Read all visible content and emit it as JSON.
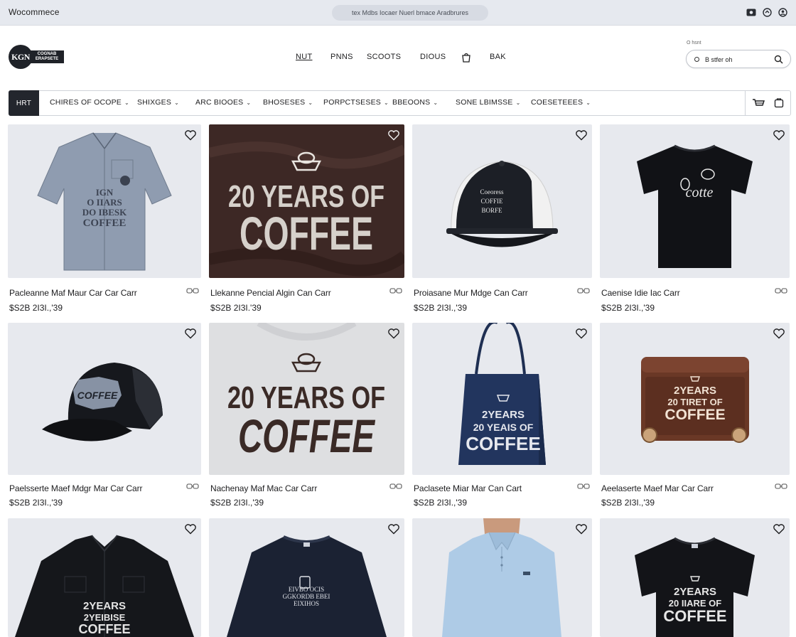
{
  "browser": {
    "title": "Wocommece",
    "url": "tex  Mdbs Iocaer Nuerl bmace  Aradbrures"
  },
  "site": {
    "logo_badge": "KGN",
    "logo_text": "COGNAB ERAPSETE",
    "nav": [
      "NUT",
      "PNNS",
      "SCOOTS",
      "DIOUS",
      "BAK"
    ],
    "search_caption": "O hsnt",
    "search_value": "B stfer oh"
  },
  "categories": {
    "home": "HRT",
    "items": [
      "CHIRES OF OCOPE",
      "SHIXGES",
      "ARC BIOOES",
      "BHOSESES",
      "PORPCTSESES",
      "BBEOONS",
      "SONE LBIMSSE",
      "COESETEEES"
    ]
  },
  "products": [
    {
      "name": "Pacleanne Maf Maur Car Car Carr",
      "price": "$S2B 2I3I.,'39",
      "image": "grey-work-shirt"
    },
    {
      "name": "Llekanne Pencial Algin Can Carr",
      "price": "$S2B 2I3I.'39",
      "image": "brown-20-years-tee"
    },
    {
      "name": "Proiasane Mur Mdge Can Carr",
      "price": "$S2B 2I3I.,'39",
      "image": "black-trucker-cap"
    },
    {
      "name": "Caenise Idie Iac Carr",
      "price": "$S2B 2I3I.,'39",
      "image": "black-tee-logo"
    },
    {
      "name": "Paelsserte Maef Mdgr Mar Car Carr",
      "price": "$S2B 2I3I.,'39",
      "image": "black-mesh-cap"
    },
    {
      "name": "Nachenay Maf Mac Car Carr",
      "price": "$S2B 2I3I.,'39",
      "image": "grey-20-years-tee"
    },
    {
      "name": "Paclasete Miar Mar Can Cart",
      "price": "$S2B 2I3I.,'39",
      "image": "navy-tote-bag"
    },
    {
      "name": "Aeelaserte Maef Mar Car Carr",
      "price": "$S2B 2I3I.,'39",
      "image": "brown-coffee-case"
    },
    {
      "name": "",
      "price": "",
      "image": "black-work-shirt"
    },
    {
      "name": "",
      "price": "",
      "image": "navy-long-sleeve"
    },
    {
      "name": "",
      "price": "",
      "image": "light-blue-polo"
    },
    {
      "name": "",
      "price": "",
      "image": "black-tee-coffee"
    }
  ],
  "graphics": {
    "big_slogan_line1": "20 YEARS OF",
    "big_slogan_line2": "COFFEE",
    "shirt_print": [
      "IGN",
      "O IIARS",
      "DO IBESK",
      "COFFEE"
    ],
    "cap_print": [
      "Coeoress",
      "COFFIE",
      "BORFE"
    ],
    "tee_print": [
      "cotte"
    ],
    "mesh_cap_patch": "COFFEE",
    "tote_print": [
      "2YEARS",
      "20 YEAIS OF",
      "COFFEE"
    ],
    "case_print": [
      "2YEARS",
      "20 TIRET OF",
      "COFFEE"
    ],
    "long_shirt_print": [
      "2YEARS",
      "2YEIBISE",
      "COFFEE"
    ],
    "long_sleeve_print": [
      "EIVBO  OCIS",
      "GGKORDB EBEI",
      "EIXIHOS"
    ],
    "tee_coffee_print": [
      "2YEARS",
      "20 IIARE OF",
      "COFFEE"
    ]
  },
  "colors": {
    "accent_dark": "#23262d",
    "page_bg": "#ffffff",
    "photo_bg": "#e7e9ee",
    "brown_tee": "#3d2825",
    "coffee_brown": "#3a2a26"
  }
}
